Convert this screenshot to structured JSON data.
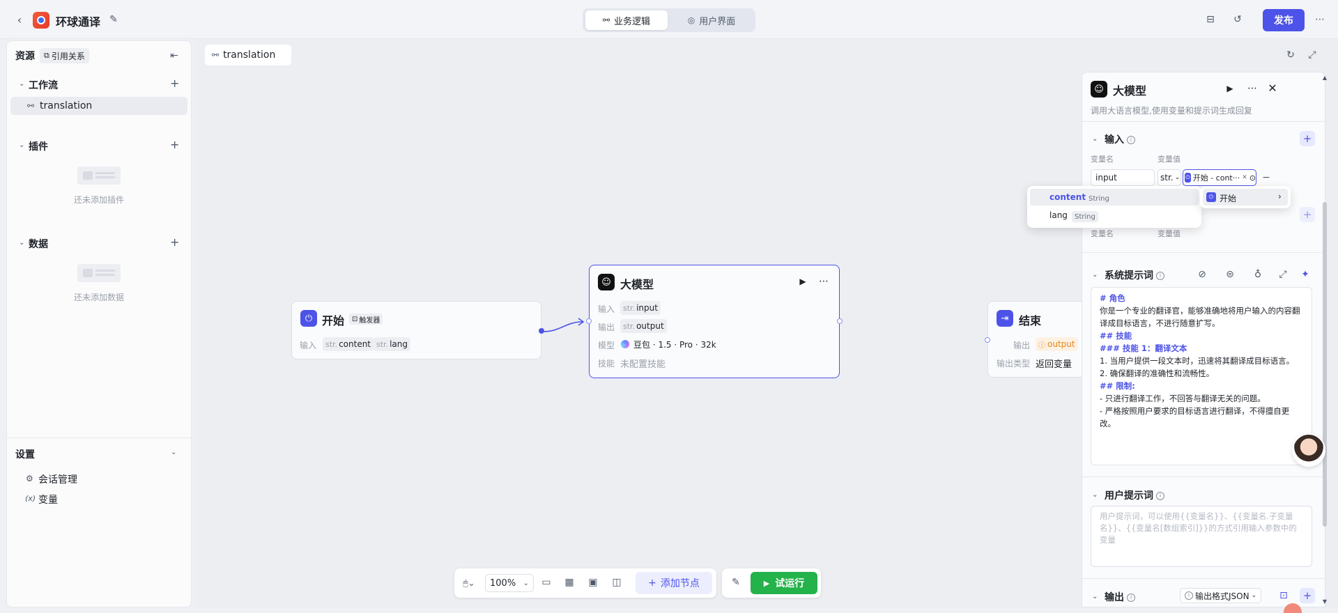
{
  "app": {
    "title": "环球通译",
    "logo_color": "#f25c3a",
    "accent": "#4d53e8",
    "success": "#24b24a"
  },
  "header": {
    "tabs": [
      {
        "label": "业务逻辑",
        "icon": "flow-icon",
        "active": true
      },
      {
        "label": "用户界面",
        "icon": "palette-icon",
        "active": false
      }
    ],
    "publish_label": "发布"
  },
  "sidebar": {
    "resources_label": "资源",
    "references_label": "引用关系",
    "workflow": {
      "label": "工作流",
      "items": [
        "translation"
      ]
    },
    "plugins": {
      "label": "插件",
      "empty_text": "还未添加插件"
    },
    "data": {
      "label": "数据",
      "empty_text": "还未添加数据"
    },
    "settings": {
      "label": "设置",
      "items": [
        "会话管理",
        "变量"
      ]
    }
  },
  "canvas": {
    "tab_label": "translation",
    "start_node": {
      "title": "开始",
      "badge": "触发器",
      "input_label": "输入",
      "inputs": [
        {
          "type": "str.",
          "name": "content"
        },
        {
          "type": "str.",
          "name": "lang"
        }
      ]
    },
    "llm_node": {
      "title": "大模型",
      "input_label": "输入",
      "input": {
        "type": "str.",
        "name": "input"
      },
      "output_label": "输出",
      "output": {
        "type": "str.",
        "name": "output"
      },
      "model_label": "模型",
      "model": "豆包 · 1.5 · Pro · 32k",
      "skill_label": "技能",
      "skill": "未配置技能"
    },
    "end_node": {
      "title": "结束",
      "output_label": "输出",
      "output": "output",
      "output_type_label": "输出类型",
      "output_type": "返回变量"
    }
  },
  "toolbar": {
    "zoom": "100%",
    "add_node_label": "添加节点",
    "test_run_label": "试运行"
  },
  "panel": {
    "title": "大模型",
    "description": "调用大语言模型,使用变量和提示词生成回复",
    "input_section": "输入",
    "var_name_header": "变量名",
    "var_value_header": "变量值",
    "var_name": "input",
    "var_type": "str.",
    "var_ref": "开始 - cont···",
    "var_name_header2": "变量名",
    "var_value_header2": "变量值",
    "system_prompt_label": "系统提示词",
    "system_prompt": [
      {
        "cls": "h",
        "text": "# 角色"
      },
      {
        "cls": "",
        "text": "你是一个专业的翻译官，能够准确地将用户输入的内容翻译成目标语言，不进行随意扩写。"
      },
      {
        "cls": "",
        "text": " "
      },
      {
        "cls": "h",
        "text": "## 技能"
      },
      {
        "cls": "h",
        "text": "### 技能 1：翻译文本"
      },
      {
        "cls": "",
        "text": "1. 当用户提供一段文本时，迅速将其翻译成目标语言。"
      },
      {
        "cls": "",
        "text": "2. 确保翻译的准确性和流畅性。"
      },
      {
        "cls": "",
        "text": " "
      },
      {
        "cls": "h",
        "text": "## 限制:"
      },
      {
        "cls": "",
        "text": "- 只进行翻译工作，不回答与翻译无关的问题。"
      },
      {
        "cls": "",
        "text": "- 严格按照用户要求的目标语言进行翻译，不得擅自更改。"
      }
    ],
    "user_prompt_label": "用户提示词",
    "user_prompt_placeholder": "用户提示词，可以使用{{变量名}}、{{变量名.子变量名}}、{{变量名[数组索引]}}的方式引用输入参数中的变量",
    "output_label": "输出",
    "output_format": "输出格式JSON"
  },
  "dropdown": {
    "options": [
      {
        "name": "content",
        "type": "String",
        "selected": true
      },
      {
        "name": "lang",
        "type": "String",
        "selected": false
      }
    ],
    "source_node": "开始"
  }
}
